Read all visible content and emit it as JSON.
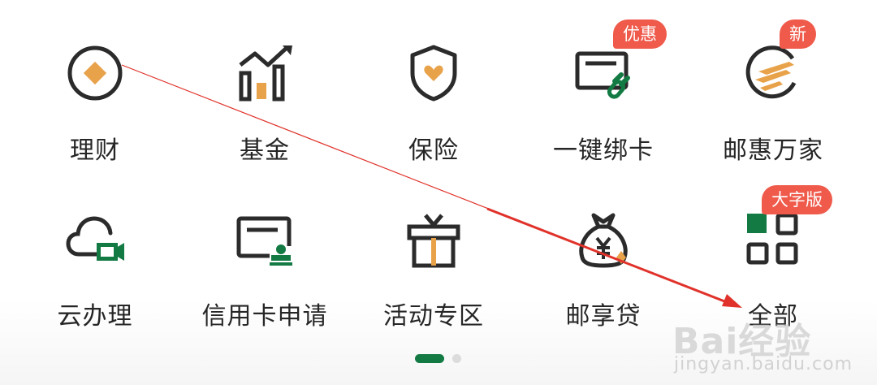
{
  "grid": {
    "row1": [
      {
        "label": "理财",
        "icon": "wealth-icon"
      },
      {
        "label": "基金",
        "icon": "fund-chart-icon"
      },
      {
        "label": "保险",
        "icon": "insurance-shield-icon"
      },
      {
        "label": "一键绑卡",
        "icon": "bind-card-icon",
        "badge": "优惠"
      },
      {
        "label": "邮惠万家",
        "icon": "youhui-wanjia-icon",
        "badge": "新"
      }
    ],
    "row2": [
      {
        "label": "云办理",
        "icon": "cloud-video-icon"
      },
      {
        "label": "信用卡申请",
        "icon": "credit-card-apply-icon"
      },
      {
        "label": "活动专区",
        "icon": "gift-box-icon"
      },
      {
        "label": "邮享贷",
        "icon": "loan-money-bag-icon"
      },
      {
        "label": "全部",
        "icon": "all-apps-grid-icon",
        "badge": "大字版"
      }
    ]
  },
  "pager": {
    "pages": 2,
    "current": 1
  },
  "watermark": {
    "brand": "Bai经验",
    "url": "jingyan.baidu.com"
  },
  "colors": {
    "icon_stroke": "#2b2b2b",
    "accent_orange": "#e8a24a",
    "accent_green": "#137a43",
    "badge_red": "#ef5a4b",
    "arrow_red": "#e0322a"
  }
}
